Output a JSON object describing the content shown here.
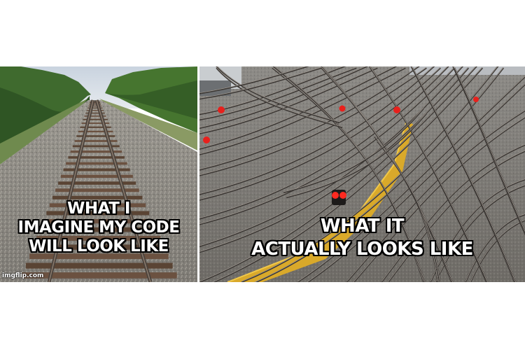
{
  "left_panel": {
    "caption_lines": [
      "WHAT I",
      "IMAGINE MY CODE",
      "WILL LOOK LIKE"
    ],
    "watermark": "imgflip.com"
  },
  "right_panel": {
    "caption_lines": [
      "WHAT IT",
      "ACTUALLY LOOKS LIKE"
    ]
  },
  "colors": {
    "caption_text": "#ffffff",
    "caption_outline": "#000000",
    "signal_red": "#e8201c",
    "platform_yellow": "#e6b422",
    "rail_steel": "#3a3633"
  }
}
